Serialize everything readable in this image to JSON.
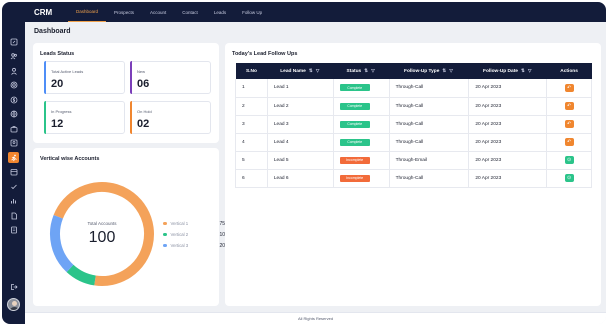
{
  "app": {
    "brand": "CRM"
  },
  "nav": {
    "items": [
      {
        "label": "Dashboard",
        "active": true
      },
      {
        "label": "Prospects",
        "active": false
      },
      {
        "label": "Account",
        "active": false
      },
      {
        "label": "Contact",
        "active": false
      },
      {
        "label": "Leads",
        "active": false
      },
      {
        "label": "Follow Up",
        "active": false
      }
    ]
  },
  "sidebar": {
    "icons": [
      "dashboard-icon",
      "users-icon",
      "user-icon",
      "target-icon",
      "dollar-icon",
      "globe-icon",
      "briefcase-icon",
      "contacts-icon",
      "running-icon",
      "calendar-icon",
      "task-icon",
      "report-icon",
      "document-icon",
      "note-icon",
      "logout-icon"
    ],
    "active_index": 8
  },
  "page": {
    "title": "Dashboard"
  },
  "leads_status": {
    "title": "Leads Status",
    "stats": [
      {
        "label": "Total Active Leads",
        "value": "20",
        "color": "#4f8ef7"
      },
      {
        "label": "New",
        "value": "06",
        "color": "#7b3fb9"
      },
      {
        "label": "In Progress",
        "value": "12",
        "color": "#2bc48a"
      },
      {
        "label": "On Hold",
        "value": "02",
        "color": "#f0862f"
      }
    ]
  },
  "accounts": {
    "title": "Vertical wise Accounts",
    "center_label": "Total Accounts",
    "center_value": "100",
    "legend": [
      {
        "name": "Vertical 1",
        "value": 75,
        "color": "#f4a25a"
      },
      {
        "name": "Vertical 2",
        "value": 10,
        "color": "#2bc48a"
      },
      {
        "name": "Vertical 3",
        "value": 20,
        "color": "#6ea4f5"
      }
    ]
  },
  "followups": {
    "title": "Today's Lead Follow Ups",
    "columns": [
      "S.No",
      "Lead Name",
      "Status",
      "Follow-Up Type",
      "Follow-Up Date",
      "Actions"
    ],
    "rows": [
      {
        "sno": "1",
        "lead": "Lead 1",
        "status": "Complete",
        "status_color": "#2bc48a",
        "type": "Through-Call",
        "date": "20 Apr 2023",
        "action": "undo",
        "action_color": "#f0862f"
      },
      {
        "sno": "2",
        "lead": "Lead 2",
        "status": "Complete",
        "status_color": "#2bc48a",
        "type": "Through-Call",
        "date": "20 Apr 2023",
        "action": "undo",
        "action_color": "#f0862f"
      },
      {
        "sno": "3",
        "lead": "Lead 3",
        "status": "Complete",
        "status_color": "#2bc48a",
        "type": "Through-Call",
        "date": "20 Apr 2023",
        "action": "undo",
        "action_color": "#f0862f"
      },
      {
        "sno": "4",
        "lead": "Lead 4",
        "status": "Complete",
        "status_color": "#2bc48a",
        "type": "Through-Call",
        "date": "20 Apr 2023",
        "action": "undo",
        "action_color": "#f0862f"
      },
      {
        "sno": "5",
        "lead": "Lead 5",
        "status": "Incomplete",
        "status_color": "#f26b3a",
        "type": "Through-Email",
        "date": "20 Apr 2023",
        "action": "check",
        "action_color": "#2bc48a"
      },
      {
        "sno": "6",
        "lead": "Lead 6",
        "status": "Incomplete",
        "status_color": "#f26b3a",
        "type": "Through-Call",
        "date": "20 Apr 2023",
        "action": "check",
        "action_color": "#2bc48a"
      }
    ]
  },
  "footer": {
    "text": "All Rights Reserved"
  }
}
